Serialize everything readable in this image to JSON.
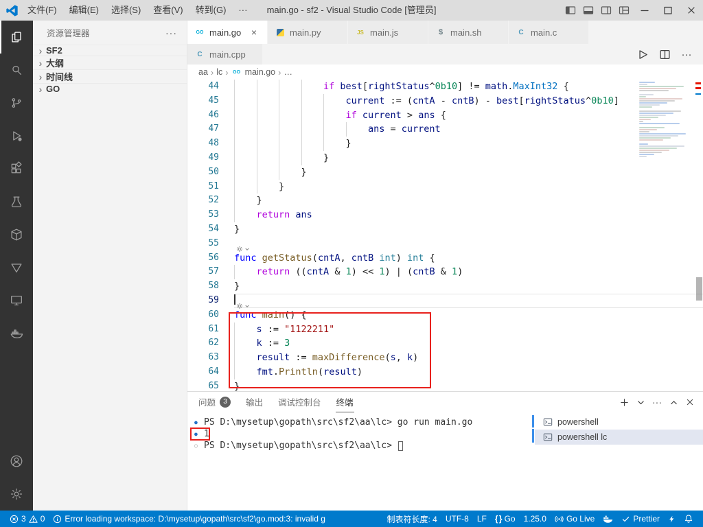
{
  "colors": {
    "status_bar": "#007acc",
    "activity_bar": "#333333",
    "annotation": "#e8211d",
    "title_bar": "#dddddd"
  },
  "title_bar": {
    "title": "main.go - sf2 - Visual Studio Code [管理员]",
    "menus": [
      "文件(F)",
      "编辑(E)",
      "选择(S)",
      "查看(V)",
      "转到(G)",
      "···"
    ],
    "layout_icons": [
      "toggle-sidebar",
      "toggle-panel",
      "toggle-secondary-sidebar",
      "customize-layout"
    ],
    "window_controls": [
      "minimize",
      "maximize",
      "close"
    ]
  },
  "activity_bar": {
    "top": [
      {
        "icon": "explorer",
        "active": true
      },
      {
        "icon": "search"
      },
      {
        "icon": "source-control"
      },
      {
        "icon": "run-debug"
      },
      {
        "icon": "extensions"
      },
      {
        "icon": "testing"
      },
      {
        "icon": "package"
      },
      {
        "icon": "funnel"
      },
      {
        "icon": "live-server"
      },
      {
        "icon": "docker"
      }
    ],
    "bottom": [
      {
        "icon": "accounts"
      },
      {
        "icon": "settings"
      }
    ]
  },
  "sidebar": {
    "title": "资源管理器",
    "more_label": "···",
    "sections": [
      {
        "key": "sf2",
        "label": "SF2"
      },
      {
        "key": "outline",
        "label": "大纲"
      },
      {
        "key": "timeline",
        "label": "时间线"
      },
      {
        "key": "go",
        "label": "GO"
      }
    ]
  },
  "editor": {
    "tabs_row1": [
      {
        "key": "main-go",
        "label": "main.go",
        "icon": "go",
        "active": true
      },
      {
        "key": "main-py",
        "label": "main.py",
        "icon": "py"
      },
      {
        "key": "main-js",
        "label": "main.js",
        "icon": "js"
      },
      {
        "key": "main-sh",
        "label": "main.sh",
        "icon": "sh"
      },
      {
        "key": "main-c",
        "label": "main.c",
        "icon": "c"
      }
    ],
    "tabs_row2": [
      {
        "key": "main-cpp",
        "label": "main.cpp",
        "icon": "cpp"
      }
    ],
    "breadcrumbs": [
      "aa",
      "lc",
      "main.go",
      "…"
    ],
    "cursor_line": 59,
    "decorations": [
      {
        "line": 56,
        "icon": "gear-run"
      },
      {
        "line": 60,
        "icon": "gear-run"
      }
    ],
    "lines": [
      {
        "n": 44,
        "indent": 4,
        "tokens": [
          [
            "k2",
            "if "
          ],
          [
            "v",
            "best"
          ],
          [
            "p",
            "["
          ],
          [
            "v",
            "rightStatus"
          ],
          [
            "p",
            "^"
          ],
          [
            "n",
            "0b10"
          ],
          [
            "p",
            "] != "
          ],
          [
            "v",
            "math"
          ],
          [
            "p",
            "."
          ],
          [
            "c",
            "MaxInt32"
          ],
          [
            "p",
            " {"
          ]
        ]
      },
      {
        "n": 45,
        "indent": 5,
        "tokens": [
          [
            "v",
            "current"
          ],
          [
            "p",
            " := ("
          ],
          [
            "v",
            "cntA"
          ],
          [
            "p",
            " - "
          ],
          [
            "v",
            "cntB"
          ],
          [
            "p",
            ") - "
          ],
          [
            "v",
            "best"
          ],
          [
            "p",
            "["
          ],
          [
            "v",
            "rightStatus"
          ],
          [
            "p",
            "^"
          ],
          [
            "n",
            "0b10"
          ],
          [
            "p",
            "]"
          ]
        ]
      },
      {
        "n": 46,
        "indent": 5,
        "tokens": [
          [
            "k2",
            "if "
          ],
          [
            "v",
            "current"
          ],
          [
            "p",
            " > "
          ],
          [
            "v",
            "ans"
          ],
          [
            "p",
            " {"
          ]
        ]
      },
      {
        "n": 47,
        "indent": 6,
        "tokens": [
          [
            "v",
            "ans"
          ],
          [
            "p",
            " = "
          ],
          [
            "v",
            "current"
          ]
        ]
      },
      {
        "n": 48,
        "indent": 5,
        "tokens": [
          [
            "p",
            "}"
          ]
        ]
      },
      {
        "n": 49,
        "indent": 4,
        "tokens": [
          [
            "p",
            "}"
          ]
        ]
      },
      {
        "n": 50,
        "indent": 3,
        "tokens": [
          [
            "p",
            "}"
          ]
        ]
      },
      {
        "n": 51,
        "indent": 2,
        "tokens": [
          [
            "p",
            "}"
          ]
        ]
      },
      {
        "n": 52,
        "indent": 1,
        "tokens": [
          [
            "p",
            "}"
          ]
        ]
      },
      {
        "n": 53,
        "indent": 1,
        "tokens": [
          [
            "k2",
            "return "
          ],
          [
            "v",
            "ans"
          ]
        ]
      },
      {
        "n": 54,
        "indent": 0,
        "tokens": [
          [
            "p",
            "}"
          ]
        ]
      },
      {
        "n": 55,
        "indent": 0,
        "tokens": []
      },
      {
        "n": 56,
        "indent": 0,
        "tokens": [
          [
            "k1",
            "func "
          ],
          [
            "f",
            "getStatus"
          ],
          [
            "p",
            "("
          ],
          [
            "v",
            "cntA"
          ],
          [
            "p",
            ", "
          ],
          [
            "v",
            "cntB"
          ],
          [
            "p",
            " "
          ],
          [
            "t",
            "int"
          ],
          [
            "p",
            ") "
          ],
          [
            "t",
            "int"
          ],
          [
            "p",
            " {"
          ]
        ]
      },
      {
        "n": 57,
        "indent": 1,
        "tokens": [
          [
            "k2",
            "return "
          ],
          [
            "p",
            "(("
          ],
          [
            "v",
            "cntA"
          ],
          [
            "p",
            " & "
          ],
          [
            "n",
            "1"
          ],
          [
            "p",
            ") << "
          ],
          [
            "n",
            "1"
          ],
          [
            "p",
            ") | ("
          ],
          [
            "v",
            "cntB"
          ],
          [
            "p",
            " & "
          ],
          [
            "n",
            "1"
          ],
          [
            "p",
            ")"
          ]
        ]
      },
      {
        "n": 58,
        "indent": 0,
        "tokens": [
          [
            "p",
            "}"
          ]
        ]
      },
      {
        "n": 59,
        "indent": 0,
        "tokens": []
      },
      {
        "n": 60,
        "indent": 0,
        "tokens": [
          [
            "k1",
            "func "
          ],
          [
            "f",
            "main"
          ],
          [
            "p",
            "() {"
          ]
        ]
      },
      {
        "n": 61,
        "indent": 1,
        "tokens": [
          [
            "v",
            "s"
          ],
          [
            "p",
            " := "
          ],
          [
            "st",
            "\"1122211\""
          ]
        ]
      },
      {
        "n": 62,
        "indent": 1,
        "tokens": [
          [
            "v",
            "k"
          ],
          [
            "p",
            " := "
          ],
          [
            "n",
            "3"
          ]
        ]
      },
      {
        "n": 63,
        "indent": 1,
        "tokens": [
          [
            "v",
            "result"
          ],
          [
            "p",
            " := "
          ],
          [
            "f",
            "maxDifference"
          ],
          [
            "p",
            "("
          ],
          [
            "v",
            "s"
          ],
          [
            "p",
            ", "
          ],
          [
            "v",
            "k"
          ],
          [
            "p",
            ")"
          ]
        ]
      },
      {
        "n": 64,
        "indent": 1,
        "tokens": [
          [
            "v",
            "fmt"
          ],
          [
            "p",
            "."
          ],
          [
            "f",
            "Println"
          ],
          [
            "p",
            "("
          ],
          [
            "v",
            "result"
          ],
          [
            "p",
            ")"
          ]
        ]
      },
      {
        "n": 65,
        "indent": 0,
        "tokens": [
          [
            "p",
            "}"
          ]
        ]
      }
    ]
  },
  "panel": {
    "tabs": [
      {
        "key": "problems",
        "label": "问题",
        "badge": "3"
      },
      {
        "key": "output",
        "label": "输出"
      },
      {
        "key": "debug-console",
        "label": "调试控制台"
      },
      {
        "key": "terminal",
        "label": "终端",
        "active": true
      }
    ],
    "actions": [
      "new-terminal",
      "terminal-profile-dropdown",
      "more-actions",
      "maximize-panel",
      "close-panel"
    ],
    "terminal": {
      "lines": [
        {
          "deco": "filled",
          "text": "PS D:\\mysetup\\gopath\\src\\sf2\\aa\\lc> go run main.go"
        },
        {
          "deco": "filled",
          "text": "1",
          "boxed": true
        },
        {
          "deco": "outline",
          "text": "PS D:\\mysetup\\gopath\\src\\sf2\\aa\\lc> ",
          "cursor": true
        }
      ]
    },
    "terminal_list": [
      {
        "label": "powershell",
        "selected": false
      },
      {
        "label": "powershell  lc",
        "selected": true
      }
    ]
  },
  "status_bar": {
    "left": [
      {
        "name": "problems",
        "error_count": "3",
        "warning_count": "0"
      },
      {
        "name": "workspace-error",
        "icon": "info",
        "text": "Error loading workspace: D:\\mysetup\\gopath\\src\\sf2\\go.mod:3: invalid g"
      }
    ],
    "right": [
      {
        "name": "tab-size",
        "label": "制表符长度: 4"
      },
      {
        "name": "encoding",
        "label": "UTF-8"
      },
      {
        "name": "eol",
        "label": "LF"
      },
      {
        "name": "language-mode",
        "icon": "braces",
        "label": "Go"
      },
      {
        "name": "go-version",
        "label": "1.25.0"
      },
      {
        "name": "go-live",
        "icon": "broadcast",
        "label": "Go Live"
      },
      {
        "name": "docker",
        "icon": "whale",
        "label": ""
      },
      {
        "name": "prettier",
        "icon": "check",
        "label": "Prettier"
      },
      {
        "name": "feedback",
        "icon": "lightning",
        "label": ""
      },
      {
        "name": "notifications",
        "icon": "bell",
        "label": ""
      }
    ]
  },
  "annotations": [
    {
      "name": "code-highlight-box",
      "target": "main-function-lines-60-64"
    },
    {
      "name": "terminal-highlight-box",
      "target": "terminal-output-1"
    }
  ]
}
